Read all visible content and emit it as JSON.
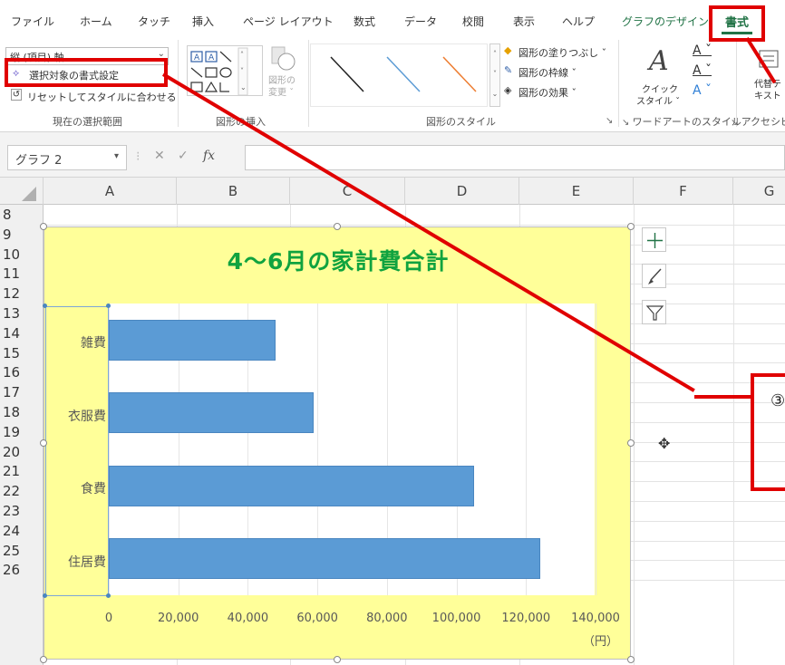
{
  "tabs": [
    "ファイル",
    "ホーム",
    "タッチ",
    "挿入",
    "ページ レイアウト",
    "数式",
    "データ",
    "校閲",
    "表示",
    "ヘルプ",
    "グラフのデザイン",
    "書式"
  ],
  "ribbon": {
    "selection_combo": "縦 (項目) 軸",
    "format_selection_btn": "選択対象の書式設定",
    "reset_style_btn": "リセットしてスタイルに合わせる",
    "group_current_selection": "現在の選択範囲",
    "change_shape": "図形の",
    "change_shape2": "変更 ˇ",
    "group_insert_shapes": "図形の挿入",
    "shape_fill": "図形の塗りつぶし ˇ",
    "shape_outline": "図形の枠線 ˇ",
    "shape_effects": "図形の効果 ˇ",
    "group_shape_styles": "図形のスタイル",
    "quick_styles": "クイック",
    "quick_styles2": "スタイル ˇ",
    "group_wordart": "ワードアートのスタイル",
    "group_accessibility": "アクセシビ",
    "alt_text": "代替テ",
    "alt_text2": "キスト"
  },
  "formula_bar": {
    "name_box": "グラフ 2",
    "fx": "fx"
  },
  "columns": [
    "A",
    "B",
    "C",
    "D",
    "E",
    "F",
    "G"
  ],
  "rows": [
    "8",
    "9",
    "10",
    "11",
    "12",
    "13",
    "14",
    "15",
    "16",
    "17",
    "18",
    "19",
    "20",
    "21",
    "22",
    "23",
    "24",
    "25",
    "26"
  ],
  "chart_data": {
    "type": "bar",
    "title": "4～6月の家計費合計",
    "categories": [
      "雑費",
      "衣服費",
      "食費",
      "住居費"
    ],
    "values": [
      48000,
      59000,
      105000,
      124000
    ],
    "xlim": [
      0,
      140000
    ],
    "xticks": [
      "0",
      "20,000",
      "40,000",
      "60,000",
      "80,000",
      "100,000",
      "120,000",
      "140,000"
    ],
    "xunit": "（円）",
    "grid": true,
    "bar_color": "#5b9bd5",
    "plot_bg": "#ffffff",
    "chart_bg": "#ffff99",
    "title_color": "#10a33f"
  },
  "annotations": {
    "step_marker": "③",
    "callout_color": "#e00000"
  }
}
